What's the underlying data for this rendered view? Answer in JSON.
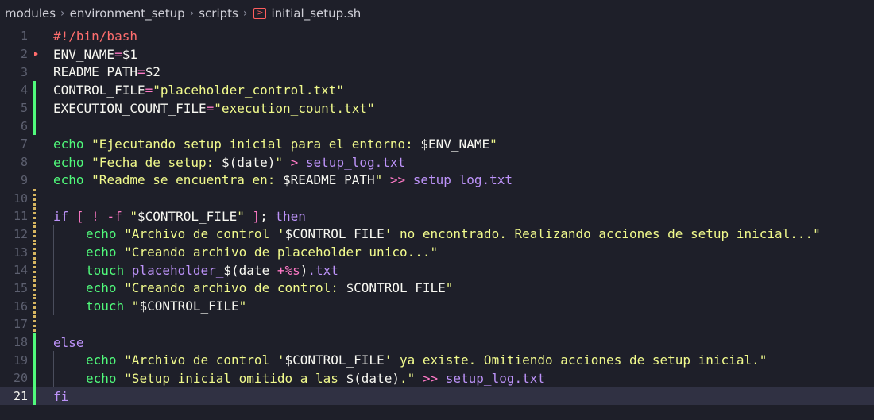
{
  "breadcrumb": {
    "items": [
      "modules",
      "environment_setup",
      "scripts",
      "initial_setup.sh"
    ],
    "icons": [
      "chevron-right-icon",
      "terminal-file-icon"
    ]
  },
  "code": [
    {
      "n": "1",
      "m": "none",
      "indent": 0,
      "tokens": [
        {
          "t": "#!/bin/bash",
          "c": "sh"
        }
      ]
    },
    {
      "n": "2",
      "m": "none",
      "indent": 0,
      "tokens": [
        {
          "t": "ENV_NAME",
          "c": "var"
        },
        {
          "t": "=",
          "c": "op"
        },
        {
          "t": "$1",
          "c": "var"
        }
      ]
    },
    {
      "n": "3",
      "m": "none",
      "indent": 0,
      "tokens": [
        {
          "t": "README_PATH",
          "c": "var"
        },
        {
          "t": "=",
          "c": "op"
        },
        {
          "t": "$2",
          "c": "var"
        }
      ]
    },
    {
      "n": "4",
      "m": "added",
      "indent": 0,
      "tokens": [
        {
          "t": "CONTROL_FILE",
          "c": "var"
        },
        {
          "t": "=",
          "c": "op"
        },
        {
          "t": "\"placeholder_control.txt\"",
          "c": "str"
        }
      ]
    },
    {
      "n": "5",
      "m": "added",
      "indent": 0,
      "tokens": [
        {
          "t": "EXECUTION_COUNT_FILE",
          "c": "var"
        },
        {
          "t": "=",
          "c": "op"
        },
        {
          "t": "\"execution_count.txt\"",
          "c": "str"
        }
      ]
    },
    {
      "n": "6",
      "m": "added",
      "indent": 0,
      "tokens": []
    },
    {
      "n": "7",
      "m": "none",
      "indent": 0,
      "tokens": [
        {
          "t": "echo ",
          "c": "str"
        },
        {
          "t": "\"Ejecutando setup inicial para el entorno: ",
          "c": "str"
        },
        {
          "t": "$ENV_NAME",
          "c": "var"
        },
        {
          "t": "\"",
          "c": "str"
        }
      ]
    },
    {
      "n": "8",
      "m": "none",
      "indent": 0,
      "tokens": [
        {
          "t": "echo ",
          "c": "str"
        },
        {
          "t": "\"Fecha de setup: ",
          "c": "str"
        },
        {
          "t": "$(date)",
          "c": "var"
        },
        {
          "t": "\" ",
          "c": "str"
        },
        {
          "t": "> ",
          "c": "op"
        },
        {
          "t": "setup_log.txt",
          "c": "file"
        }
      ]
    },
    {
      "n": "9",
      "m": "none",
      "indent": 0,
      "tokens": [
        {
          "t": "echo ",
          "c": "str"
        },
        {
          "t": "\"Readme se encuentra en: ",
          "c": "str"
        },
        {
          "t": "$README_PATH",
          "c": "var"
        },
        {
          "t": "\" ",
          "c": "str"
        },
        {
          "t": ">> ",
          "c": "op"
        },
        {
          "t": "setup_log.txt",
          "c": "file"
        }
      ]
    },
    {
      "n": "10",
      "m": "modified",
      "indent": 0,
      "tokens": []
    },
    {
      "n": "11",
      "m": "modified",
      "indent": 0,
      "tokens": [
        {
          "t": "if ",
          "c": "ctl"
        },
        {
          "t": "[ ",
          "c": "op"
        },
        {
          "t": "! ",
          "c": "op"
        },
        {
          "t": "-f ",
          "c": "op"
        },
        {
          "t": "\"",
          "c": "str"
        },
        {
          "t": "$CONTROL_FILE",
          "c": "var"
        },
        {
          "t": "\" ",
          "c": "str"
        },
        {
          "t": "]",
          "c": "op"
        },
        {
          "t": "; ",
          "c": "var"
        },
        {
          "t": "then",
          "c": "ctl"
        }
      ]
    },
    {
      "n": "12",
      "m": "modified",
      "indent": 1,
      "tokens": [
        {
          "t": "echo ",
          "c": "str"
        },
        {
          "t": "\"Archivo de control '",
          "c": "str"
        },
        {
          "t": "$CONTROL_FILE",
          "c": "var"
        },
        {
          "t": "' no encontrado. Realizando acciones de setup inicial...\"",
          "c": "str"
        }
      ]
    },
    {
      "n": "13",
      "m": "modified",
      "indent": 1,
      "tokens": [
        {
          "t": "echo ",
          "c": "str"
        },
        {
          "t": "\"Creando archivo de placeholder unico...\"",
          "c": "str"
        }
      ]
    },
    {
      "n": "14",
      "m": "modified",
      "indent": 1,
      "tokens": [
        {
          "t": "touch ",
          "c": "str"
        },
        {
          "t": "placeholder_",
          "c": "file"
        },
        {
          "t": "$(date ",
          "c": "var"
        },
        {
          "t": "+%s",
          "c": "op"
        },
        {
          "t": ")",
          "c": "var"
        },
        {
          "t": ".txt",
          "c": "file"
        }
      ]
    },
    {
      "n": "15",
      "m": "modified",
      "indent": 1,
      "tokens": [
        {
          "t": "echo ",
          "c": "str"
        },
        {
          "t": "\"Creando archivo de control: ",
          "c": "str"
        },
        {
          "t": "$CONTROL_FILE",
          "c": "var"
        },
        {
          "t": "\"",
          "c": "str"
        }
      ]
    },
    {
      "n": "16",
      "m": "modified",
      "indent": 1,
      "tokens": [
        {
          "t": "touch ",
          "c": "str"
        },
        {
          "t": "\"",
          "c": "str"
        },
        {
          "t": "$CONTROL_FILE",
          "c": "var"
        },
        {
          "t": "\"",
          "c": "str"
        }
      ]
    },
    {
      "n": "17",
      "m": "modified",
      "indent": 0,
      "tokens": []
    },
    {
      "n": "18",
      "m": "added",
      "indent": 0,
      "tokens": [
        {
          "t": "else",
          "c": "ctl"
        }
      ]
    },
    {
      "n": "19",
      "m": "added",
      "indent": 1,
      "tokens": [
        {
          "t": "echo ",
          "c": "str"
        },
        {
          "t": "\"Archivo de control '",
          "c": "str"
        },
        {
          "t": "$CONTROL_FILE",
          "c": "var"
        },
        {
          "t": "' ya existe. Omitiendo acciones de setup inicial.\"",
          "c": "str"
        }
      ]
    },
    {
      "n": "20",
      "m": "added",
      "indent": 1,
      "tokens": [
        {
          "t": "echo ",
          "c": "str"
        },
        {
          "t": "\"Setup inicial omitido a las ",
          "c": "str"
        },
        {
          "t": "$(date)",
          "c": "var"
        },
        {
          "t": ".\"",
          "c": "str"
        },
        {
          "t": " >> ",
          "c": "op"
        },
        {
          "t": "setup_log.txt",
          "c": "file"
        }
      ]
    },
    {
      "n": "21",
      "m": "added",
      "indent": 0,
      "current": true,
      "tokens": [
        {
          "t": "fi",
          "c": "ctl"
        }
      ]
    }
  ]
}
